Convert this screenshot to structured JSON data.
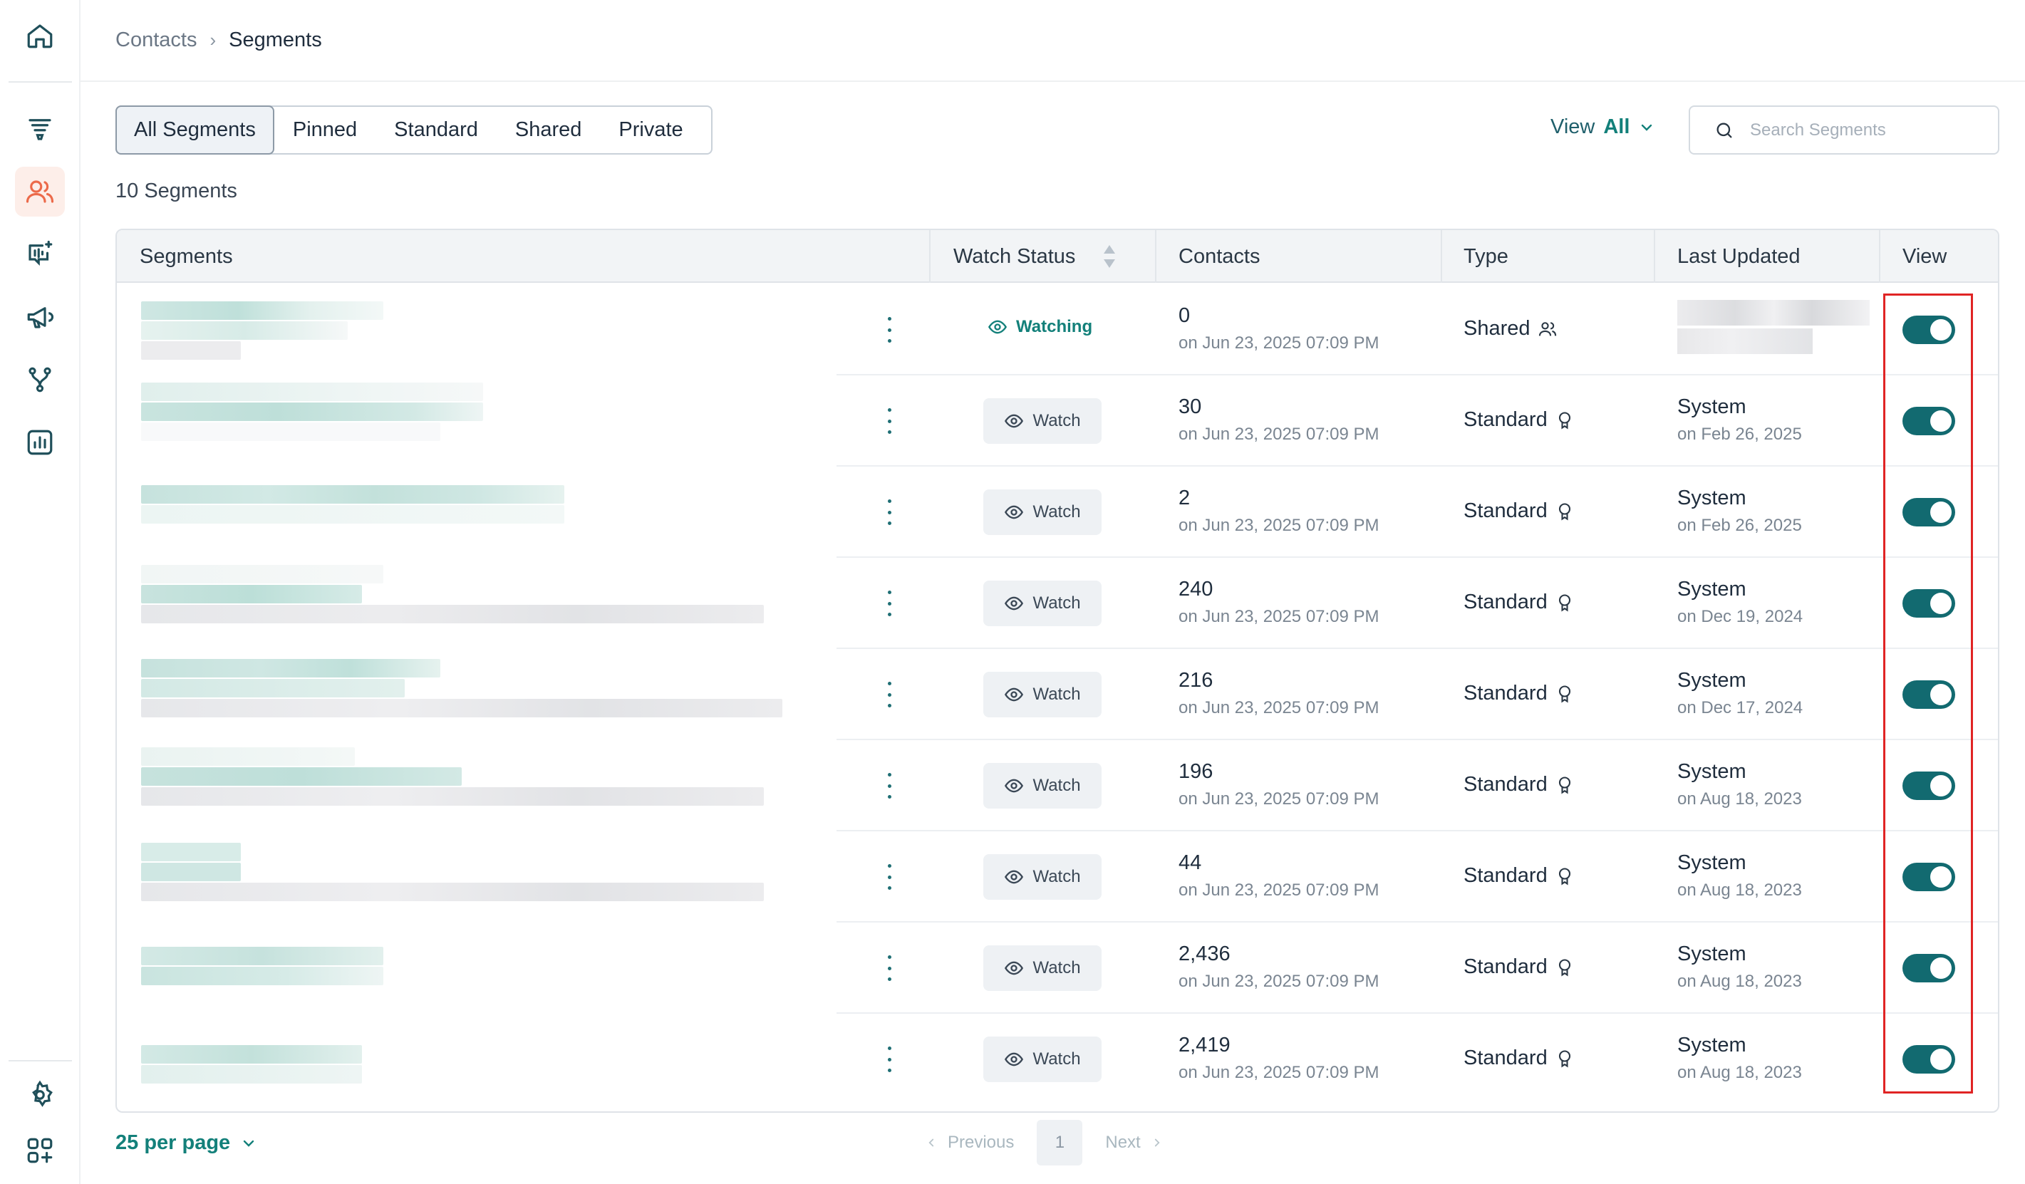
{
  "breadcrumb": {
    "parent": "Contacts",
    "separator": "›",
    "current": "Segments"
  },
  "tabs": [
    {
      "label": "All Segments",
      "active": true
    },
    {
      "label": "Pinned",
      "active": false
    },
    {
      "label": "Standard",
      "active": false
    },
    {
      "label": "Shared",
      "active": false
    },
    {
      "label": "Private",
      "active": false
    }
  ],
  "segment_count": "10 Segments",
  "view_filter": {
    "label": "View",
    "value": "All"
  },
  "search": {
    "placeholder": "Search Segments",
    "value": ""
  },
  "table": {
    "headers": {
      "segments": "Segments",
      "watch_status": "Watch Status",
      "contacts": "Contacts",
      "type": "Type",
      "last_updated": "Last Updated",
      "view": "View"
    },
    "rows": [
      {
        "watch": "Watching",
        "watching": true,
        "contacts": "0",
        "contacts_date": "on Jun 23, 2025 07:09 PM",
        "type": "Shared",
        "type_icon": "users-icon",
        "updated_by": "",
        "updated_on": "",
        "view_on": true
      },
      {
        "watch": "Watch",
        "watching": false,
        "contacts": "30",
        "contacts_date": "on Jun 23, 2025 07:09 PM",
        "type": "Standard",
        "type_icon": "award-icon",
        "updated_by": "System",
        "updated_on": "on Feb 26, 2025",
        "view_on": true
      },
      {
        "watch": "Watch",
        "watching": false,
        "contacts": "2",
        "contacts_date": "on Jun 23, 2025 07:09 PM",
        "type": "Standard",
        "type_icon": "award-icon",
        "updated_by": "System",
        "updated_on": "on Feb 26, 2025",
        "view_on": true
      },
      {
        "watch": "Watch",
        "watching": false,
        "contacts": "240",
        "contacts_date": "on Jun 23, 2025 07:09 PM",
        "type": "Standard",
        "type_icon": "award-icon",
        "updated_by": "System",
        "updated_on": "on Dec 19, 2024",
        "view_on": true
      },
      {
        "watch": "Watch",
        "watching": false,
        "contacts": "216",
        "contacts_date": "on Jun 23, 2025 07:09 PM",
        "type": "Standard",
        "type_icon": "award-icon",
        "updated_by": "System",
        "updated_on": "on Dec 17, 2024",
        "view_on": true
      },
      {
        "watch": "Watch",
        "watching": false,
        "contacts": "196",
        "contacts_date": "on Jun 23, 2025 07:09 PM",
        "type": "Standard",
        "type_icon": "award-icon",
        "updated_by": "System",
        "updated_on": "on Aug 18, 2023",
        "view_on": true
      },
      {
        "watch": "Watch",
        "watching": false,
        "contacts": "44",
        "contacts_date": "on Jun 23, 2025 07:09 PM",
        "type": "Standard",
        "type_icon": "award-icon",
        "updated_by": "System",
        "updated_on": "on Aug 18, 2023",
        "view_on": true
      },
      {
        "watch": "Watch",
        "watching": false,
        "contacts": "2,436",
        "contacts_date": "on Jun 23, 2025 07:09 PM",
        "type": "Standard",
        "type_icon": "award-icon",
        "updated_by": "System",
        "updated_on": "on Aug 18, 2023",
        "view_on": true
      },
      {
        "watch": "Watch",
        "watching": false,
        "contacts": "2,419",
        "contacts_date": "on Jun 23, 2025 07:09 PM",
        "type": "Standard",
        "type_icon": "award-icon",
        "updated_by": "System",
        "updated_on": "on Aug 18, 2023",
        "view_on": true
      }
    ]
  },
  "footer": {
    "per_page": "25 per page",
    "previous": "Previous",
    "page": "1",
    "next": "Next"
  },
  "sidebar_icons": [
    "home-icon",
    "funnel-icon",
    "contacts-icon",
    "ai-chat-icon",
    "megaphone-icon",
    "workflow-icon",
    "reports-icon",
    "settings-icon",
    "apps-add-icon"
  ],
  "colors": {
    "accent": "#13807a",
    "toggle": "#126a70",
    "active_nav": "#fdeee9",
    "highlight": "#e02424"
  }
}
